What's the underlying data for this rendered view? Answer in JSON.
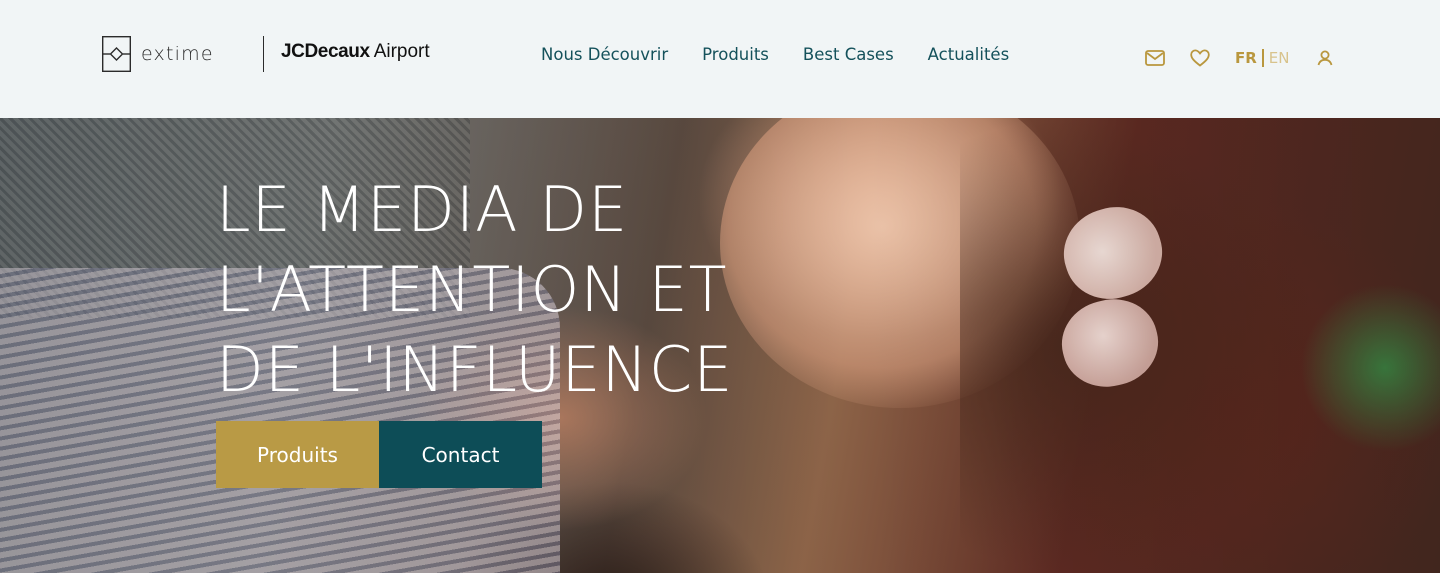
{
  "header": {
    "brand_extime": "extime",
    "brand_jcdecaux": "JCDecaux",
    "brand_airport": "Airport",
    "nav": [
      {
        "label": "Nous Découvrir"
      },
      {
        "label": "Produits"
      },
      {
        "label": "Best Cases"
      },
      {
        "label": "Actualités"
      }
    ],
    "tools": {
      "mail_icon": "mail-icon",
      "favorites_icon": "heart-icon",
      "lang_active": "FR",
      "lang_other": "EN",
      "user_icon": "user-icon"
    }
  },
  "hero": {
    "title": "LE MEDIA DE\nL'ATTENTION ET\nDE L'INFLUENCE",
    "cta_primary": "Produits",
    "cta_secondary": "Contact"
  },
  "colors": {
    "nav_text": "#14515b",
    "accent_gold": "#b99a45",
    "accent_teal": "#0d4d57",
    "header_bg": "#f1f5f6"
  }
}
